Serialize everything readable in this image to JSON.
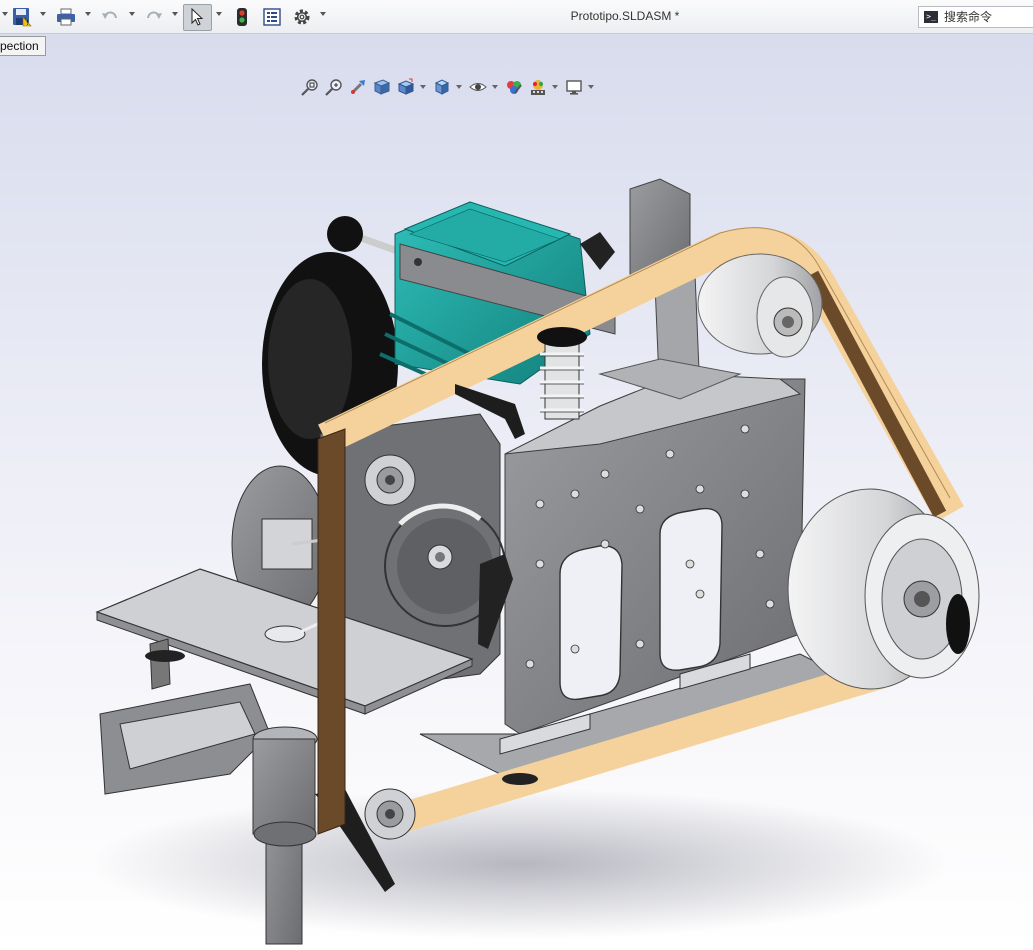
{
  "window": {
    "document_title": "Prototipo.SLDASM *"
  },
  "search": {
    "placeholder": "搜索命令",
    "icon": "command-prompt-icon"
  },
  "tooltip": {
    "text": "pection"
  },
  "quick_access": [
    {
      "name": "save-icon"
    },
    {
      "name": "print-icon"
    },
    {
      "name": "undo-icon"
    },
    {
      "name": "redo-icon"
    },
    {
      "name": "select-arrow-icon"
    },
    {
      "name": "rebuild-traffic-light-icon"
    },
    {
      "name": "file-properties-icon"
    },
    {
      "name": "options-gear-icon"
    }
  ],
  "heads_up_toolbar": [
    {
      "name": "zoom-to-fit-icon"
    },
    {
      "name": "zoom-to-area-icon"
    },
    {
      "name": "previous-view-icon"
    },
    {
      "name": "section-view-icon"
    },
    {
      "name": "view-orientation-icon"
    },
    {
      "name": "display-style-icon"
    },
    {
      "name": "hide-show-items-icon"
    },
    {
      "name": "edit-appearance-icon"
    },
    {
      "name": "apply-scene-icon"
    },
    {
      "name": "view-settings-icon"
    }
  ],
  "colors": {
    "belt": "#f5d29b",
    "belt_side": "#6b4a2a",
    "motor": "#1b9d99",
    "steel": "#7b7c80",
    "aluminum": "#d9dadc"
  }
}
